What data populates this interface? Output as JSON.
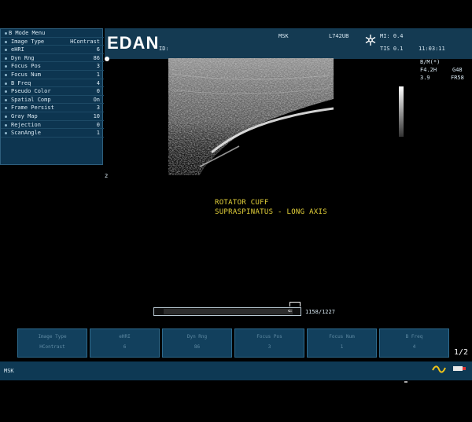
{
  "header": {
    "logo": "EDAN",
    "id_label": "ID:",
    "preset": "MSK",
    "probe": "L742UB",
    "mi": "MI: 0.4",
    "tis": "TIS 0.1",
    "time": "11:03:11",
    "freeze_icon": "snowflake-icon"
  },
  "menu": {
    "title": "B Mode Menu",
    "items": [
      {
        "label": "Image Type",
        "value": "HContrast"
      },
      {
        "label": "eHRI",
        "value": "6"
      },
      {
        "label": "Dyn Rng",
        "value": "86"
      },
      {
        "label": "Focus Pos",
        "value": "3"
      },
      {
        "label": "Focus Num",
        "value": "1"
      },
      {
        "label": "B Freq",
        "value": "4"
      },
      {
        "label": "Pseudo Color",
        "value": "0"
      },
      {
        "label": "Spatial Comp",
        "value": "On"
      },
      {
        "label": "Frame Persist",
        "value": "3"
      },
      {
        "label": "Gray Map",
        "value": "10"
      },
      {
        "label": "Rejection",
        "value": "0"
      },
      {
        "label": "ScanAngle",
        "value": "1"
      }
    ]
  },
  "info": {
    "line1": "B/M(*)",
    "line2a": "F4.2H",
    "line2b": "G48",
    "line3a": "3.9",
    "line3b": "FR58"
  },
  "depth_marker": "2",
  "annotation": {
    "line1": "ROTATOR CUFF",
    "line2": "SUPRASPINATUS - LONG AXIS"
  },
  "cine": {
    "counter": "1158/1227",
    "progress": 0.94
  },
  "softkeys": [
    {
      "label": "Image Type",
      "value": "HContrast"
    },
    {
      "label": "eHRI",
      "value": "6"
    },
    {
      "label": "Dyn Rng",
      "value": "86"
    },
    {
      "label": "Focus Pos",
      "value": "3"
    },
    {
      "label": "Focus Num",
      "value": "1"
    },
    {
      "label": "B Freq",
      "value": "4"
    }
  ],
  "page_indicator": "1/2",
  "status": {
    "text": "MSK",
    "wave_icon": "waveform-icon",
    "usb_icon": "usb-icon"
  }
}
